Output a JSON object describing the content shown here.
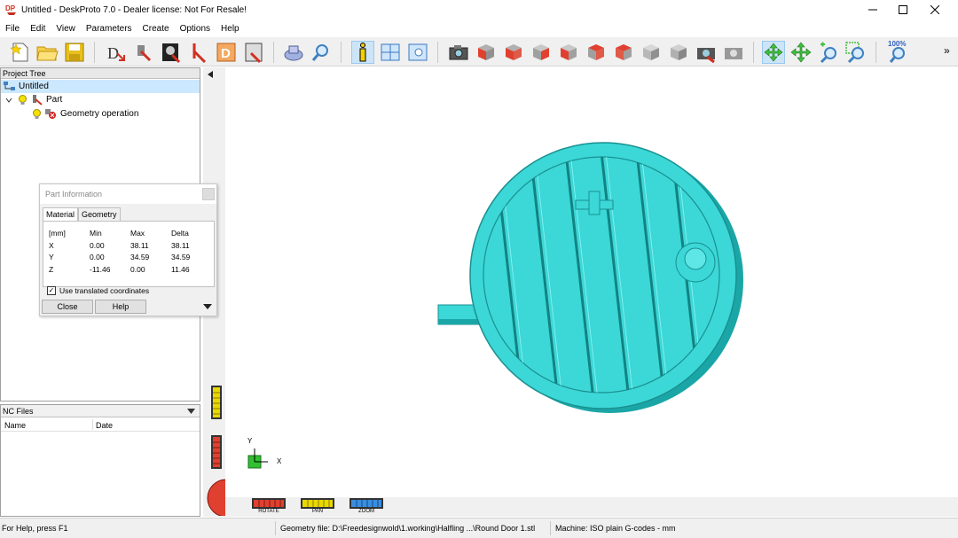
{
  "window": {
    "title": "Untitled - DeskProto 7.0 - Dealer license: Not For Resale!",
    "app_icon_text": "DP"
  },
  "menu": [
    "File",
    "Edit",
    "View",
    "Parameters",
    "Create",
    "Options",
    "Help"
  ],
  "toolbar": {
    "zoom_percent_label": "100%",
    "overflow": "»"
  },
  "project_tree": {
    "header": "Project Tree",
    "root": "Untitled",
    "part": "Part",
    "operation": "Geometry operation"
  },
  "nc_files": {
    "header": "NC Files",
    "col_name": "Name",
    "col_date": "Date"
  },
  "part_info": {
    "title": "Part Information",
    "tabs": [
      "Material",
      "Geometry"
    ],
    "headers": [
      "[mm]",
      "Min",
      "Max",
      "Delta"
    ],
    "rows": [
      {
        "axis": "X",
        "min": "0.00",
        "max": "38.11",
        "delta": "38.11"
      },
      {
        "axis": "Y",
        "min": "0.00",
        "max": "34.59",
        "delta": "34.59"
      },
      {
        "axis": "Z",
        "min": "-11.46",
        "max": "0.00",
        "delta": "11.46"
      }
    ],
    "checkbox_label": "Use translated coordinates",
    "checkbox_checked": true,
    "close_label": "Close",
    "help_label": "Help"
  },
  "viewport": {
    "axis_y": "Y",
    "axis_x": "X",
    "model_color": "#3cd7d7",
    "ctrl_rotate": "ROTATE",
    "ctrl_pan": "PAN",
    "ctrl_zoom": "ZOOM"
  },
  "status": {
    "help": "For Help, press F1",
    "geometry": "Geometry file: D:\\Freedesignwold\\1.working\\Halfling ...\\Round Door 1.stl",
    "machine": "Machine: ISO plain G-codes - mm"
  }
}
